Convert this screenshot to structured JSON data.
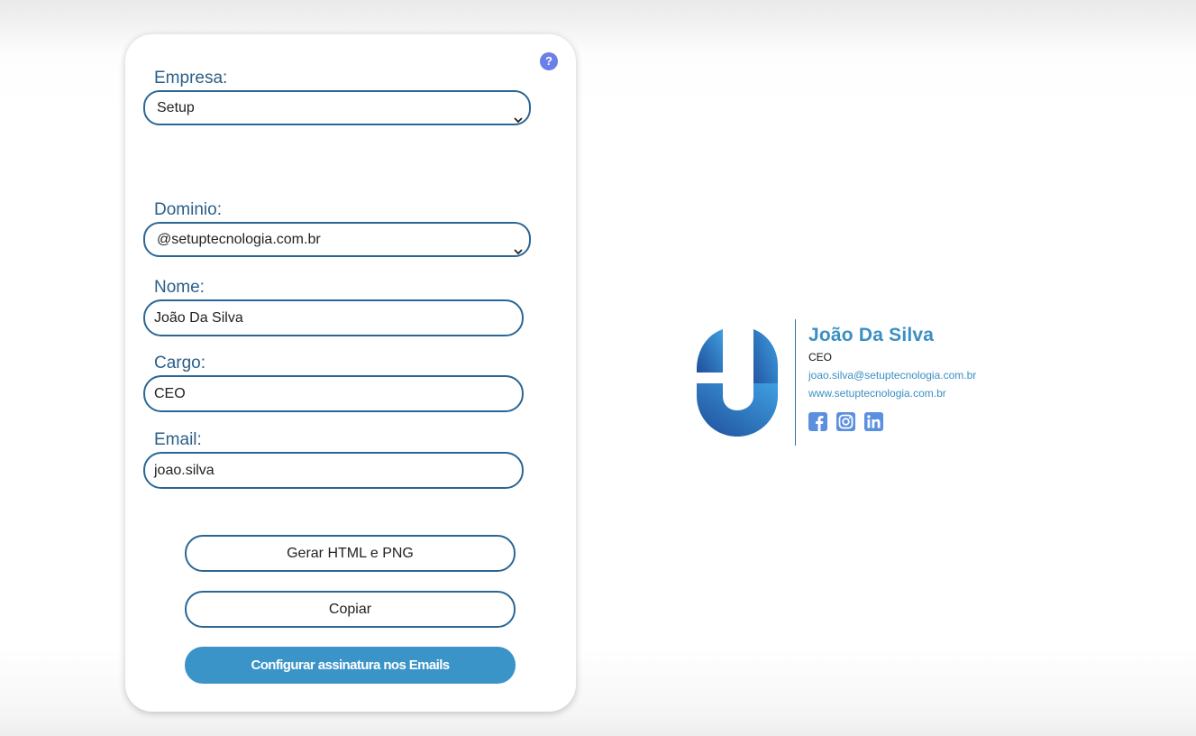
{
  "form": {
    "help_label": "?",
    "empresa": {
      "label": "Empresa:",
      "selected": "Setup"
    },
    "dominio": {
      "label": "Dominio:",
      "selected": "@setuptecnologia.com.br"
    },
    "nome": {
      "label": "Nome:",
      "value": "João Da Silva"
    },
    "cargo": {
      "label": "Cargo:",
      "value": "CEO"
    },
    "email": {
      "label": "Email:",
      "value": "joao.silva"
    },
    "buttons": {
      "gerar": "Gerar HTML e PNG",
      "copiar": "Copiar",
      "configurar": "Configurar assinatura nos Emails"
    }
  },
  "signature": {
    "name": "João Da Silva",
    "role": "CEO",
    "email": "joao.silva@setuptecnologia.com.br",
    "website": "www.setuptecnologia.com.br",
    "social_icons": [
      "facebook-icon",
      "instagram-icon",
      "linkedin-icon"
    ]
  },
  "colors": {
    "accent": "#3a94c8",
    "border": "#2b6694",
    "label": "#2b5f8a",
    "help": "#6b7fe8",
    "social": "#5b8fe0"
  }
}
